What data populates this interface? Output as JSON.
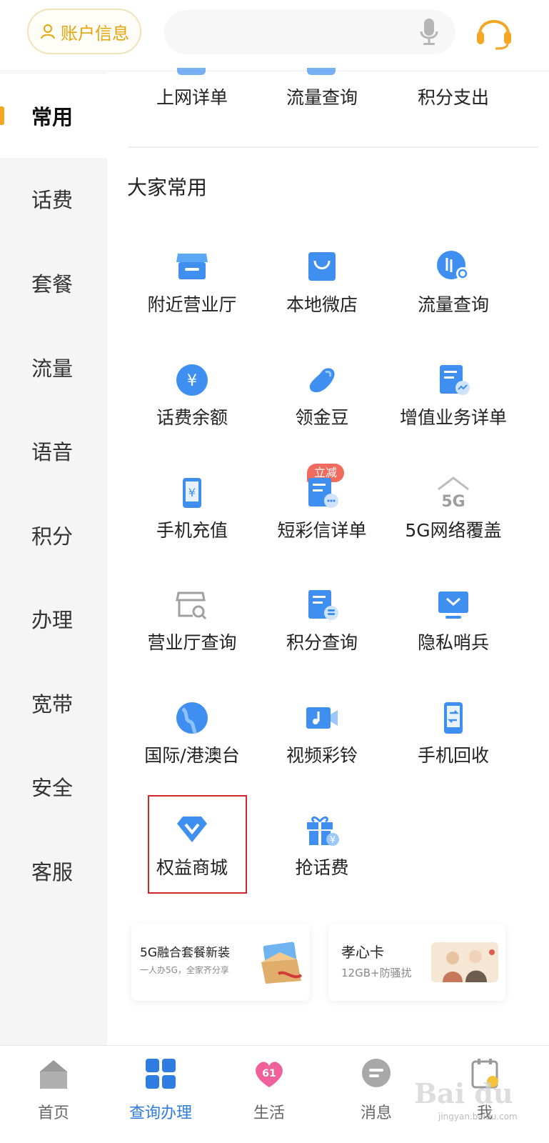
{
  "header": {
    "account_label": "账户信息",
    "search_placeholder": ""
  },
  "sidebar": {
    "items": [
      {
        "label": "常用",
        "active": true
      },
      {
        "label": "话费"
      },
      {
        "label": "套餐"
      },
      {
        "label": "流量"
      },
      {
        "label": "语音"
      },
      {
        "label": "积分"
      },
      {
        "label": "办理"
      },
      {
        "label": "宽带"
      },
      {
        "label": "安全"
      },
      {
        "label": "客服"
      }
    ]
  },
  "main": {
    "top_items": [
      {
        "label": "上网详单"
      },
      {
        "label": "流量查询"
      },
      {
        "label": "积分支出"
      }
    ],
    "section_title": "大家常用",
    "grid": [
      {
        "label": "附近营业厅",
        "icon": "store-icon"
      },
      {
        "label": "本地微店",
        "icon": "shopping-bag-icon"
      },
      {
        "label": "流量查询",
        "icon": "data-query-icon"
      },
      {
        "label": "话费余额",
        "icon": "yuan-coin-icon"
      },
      {
        "label": "领金豆",
        "icon": "bean-icon"
      },
      {
        "label": "增值业务详单",
        "icon": "document-chart-icon"
      },
      {
        "label": "手机充值",
        "icon": "phone-topup-icon",
        "badge": "立减"
      },
      {
        "label": "短彩信详单",
        "icon": "document-message-icon"
      },
      {
        "label": "5G网络覆盖",
        "icon": "5g-coverage-icon"
      },
      {
        "label": "营业厅查询",
        "icon": "store-search-icon"
      },
      {
        "label": "积分查询",
        "icon": "document-coins-icon"
      },
      {
        "label": "隐私哨兵",
        "icon": "privacy-monitor-icon"
      },
      {
        "label": "国际/港澳台",
        "icon": "globe-icon"
      },
      {
        "label": "视频彩铃",
        "icon": "video-ringtone-icon"
      },
      {
        "label": "手机回收",
        "icon": "phone-recycle-icon"
      },
      {
        "label": "权益商城",
        "icon": "diamond-v-icon"
      },
      {
        "label": "抢话费",
        "icon": "gift-icon"
      }
    ],
    "promos": [
      {
        "title": "5G融合套餐新装",
        "subtitle": "一人办5G，全家齐分享"
      },
      {
        "title": "孝心卡",
        "subtitle": "12GB+防骚扰"
      }
    ]
  },
  "bottom_nav": [
    {
      "label": "首页",
      "icon": "home-icon"
    },
    {
      "label": "查询办理",
      "icon": "grid-apps-icon",
      "active": true
    },
    {
      "label": "生活",
      "icon": "heart-61-icon"
    },
    {
      "label": "消息",
      "icon": "message-icon"
    },
    {
      "label": "我",
      "icon": "profile-icon"
    }
  ],
  "watermark": {
    "text": "Bai du",
    "sub": "jingyan.baidu.com"
  },
  "colors": {
    "accent_blue": "#2f7de1",
    "accent_orange": "#f5a623",
    "highlight_red": "#d0262a"
  }
}
